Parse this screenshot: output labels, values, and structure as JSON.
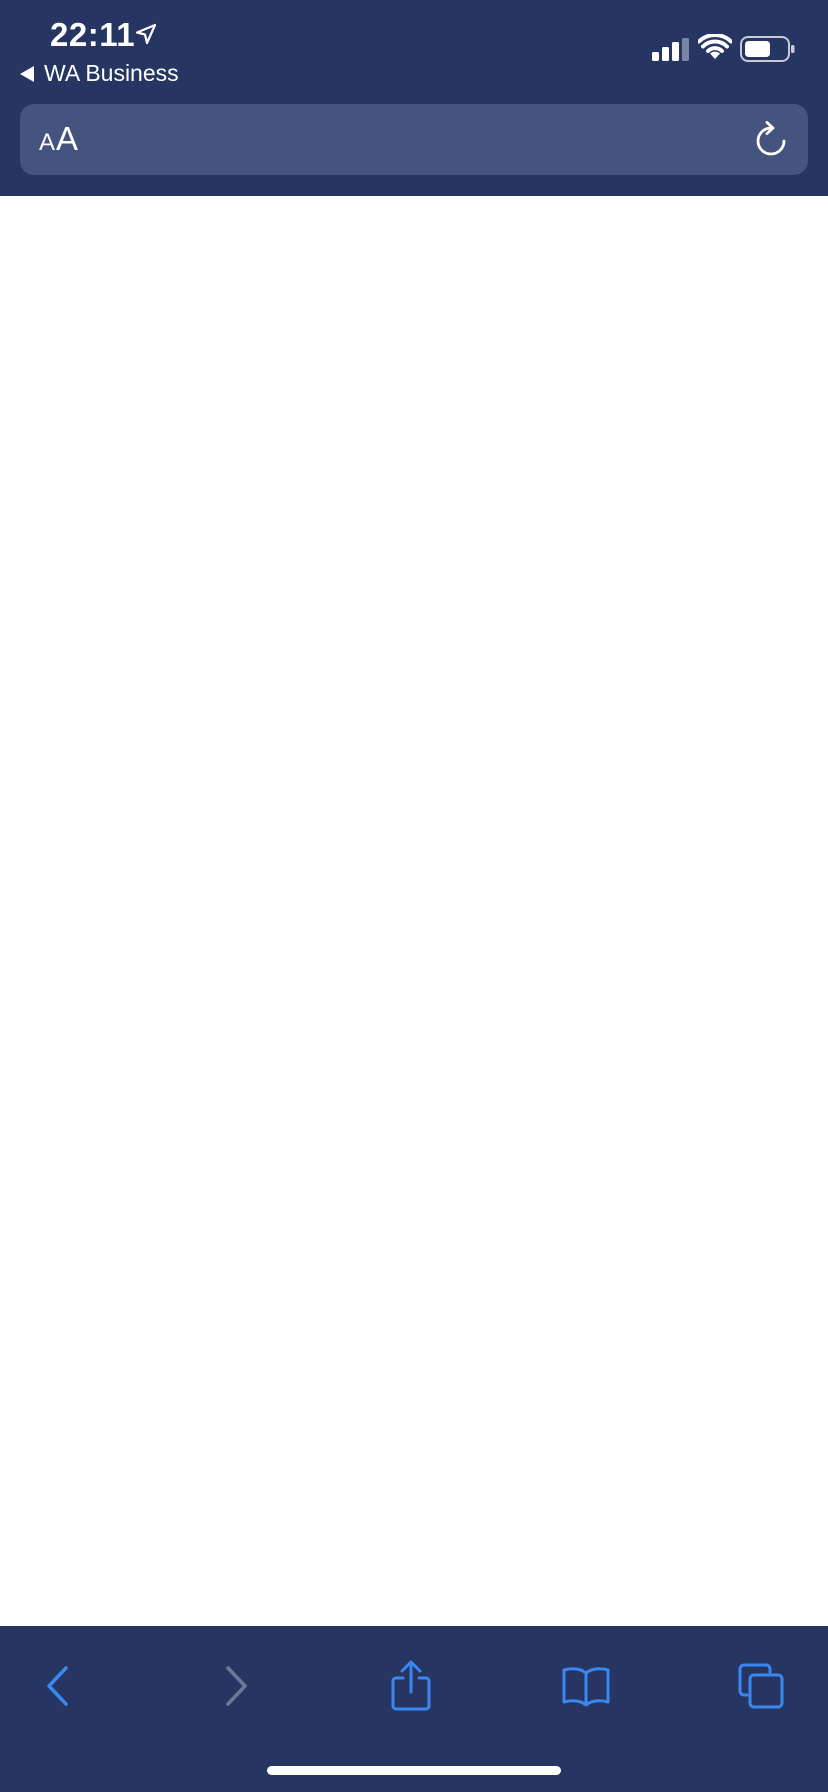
{
  "status_bar": {
    "time": "22:11",
    "back_app_label": "WA Business"
  },
  "address_bar": {
    "text_size_small": "A",
    "text_size_large": "A"
  },
  "toolbar": {
    "buttons": [
      "back",
      "forward",
      "share",
      "bookmarks",
      "tabs"
    ]
  },
  "colors": {
    "bar_background": "#263561",
    "address_field": "#45547f",
    "accent": "#3a87f2",
    "disabled": "#6e7a95"
  }
}
